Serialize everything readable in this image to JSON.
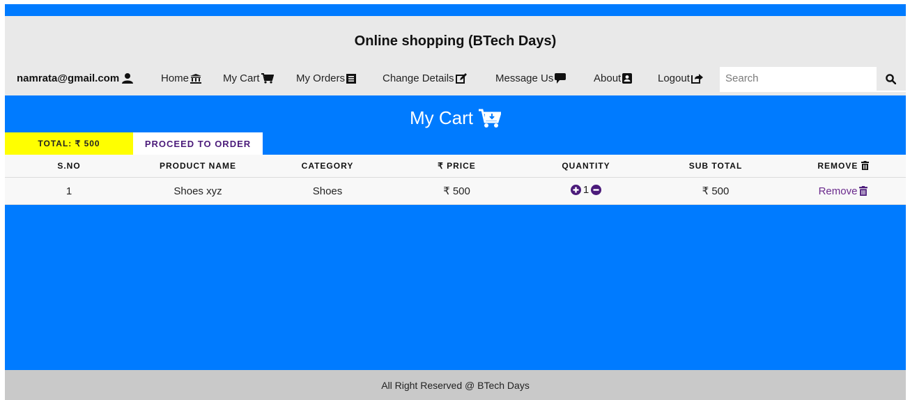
{
  "header": {
    "title": "Online shopping (BTech Days)",
    "user_email": "namrata@gmail.com",
    "nav": {
      "home": "Home",
      "my_cart": "My Cart",
      "my_orders": "My Orders",
      "change_details": "Change Details",
      "message_us": "Message Us",
      "about": "About",
      "logout": "Logout"
    },
    "search": {
      "placeholder": "Search",
      "value": ""
    }
  },
  "page": {
    "heading": "My Cart",
    "total_label": "TOTAL: ₹ 500",
    "proceed_label": "PROCEED TO ORDER"
  },
  "table": {
    "columns": [
      "S.NO",
      "PRODUCT NAME",
      "CATEGORY",
      "₹ PRICE",
      "QUANTITY",
      "SUB TOTAL",
      "REMOVE"
    ],
    "rows": [
      {
        "sno": "1",
        "product": "Shoes xyz",
        "category": "Shoes",
        "price": "₹ 500",
        "quantity": "1",
        "subtotal": "₹ 500",
        "remove": "Remove"
      }
    ]
  },
  "footer": {
    "text": "All Right Reserved @ BTech Days"
  },
  "colors": {
    "primary": "#007bff",
    "header_bg": "#e9e9e9",
    "total_bg": "#ffff00",
    "link": "#6a2a8c",
    "footer_bg": "#c9c9c9"
  },
  "icons": [
    "user-icon",
    "bank-icon",
    "cart-icon",
    "receipt-icon",
    "edit-icon",
    "comment-icon",
    "contact-icon",
    "logout-icon",
    "search-icon",
    "plus-circle-icon",
    "minus-circle-icon",
    "trash-icon"
  ]
}
